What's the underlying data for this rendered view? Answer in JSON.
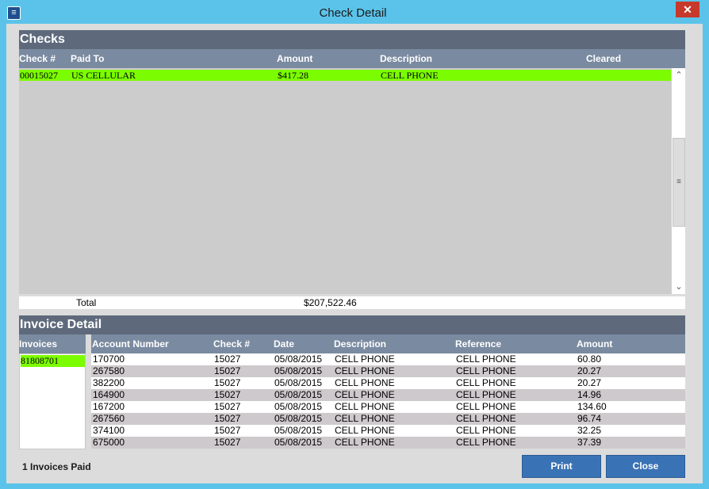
{
  "window": {
    "title": "Check Detail",
    "close_glyph": "✕",
    "icon": "app-icon"
  },
  "checks": {
    "section_title": "Checks",
    "columns": [
      "Check #",
      "Paid To",
      "Amount",
      "Description",
      "Cleared"
    ],
    "rows": [
      {
        "check_no": "00015027",
        "paid_to": "US CELLULAR",
        "amount": "$417.28",
        "description": "CELL PHONE",
        "cleared": ""
      }
    ],
    "total_label": "Total",
    "total_value": "$207,522.46"
  },
  "invoice_detail": {
    "section_title": "Invoice Detail",
    "invoices_header": "Invoices",
    "invoices": [
      "81808701"
    ],
    "columns": [
      "Account Number",
      "Check #",
      "Date",
      "Description",
      "Reference",
      "Amount"
    ],
    "rows": [
      [
        "170700",
        "15027",
        "05/08/2015",
        "CELL PHONE",
        "CELL PHONE",
        "60.80"
      ],
      [
        "267580",
        "15027",
        "05/08/2015",
        "CELL PHONE",
        "CELL PHONE",
        "20.27"
      ],
      [
        "382200",
        "15027",
        "05/08/2015",
        "CELL PHONE",
        "CELL PHONE",
        "20.27"
      ],
      [
        "164900",
        "15027",
        "05/08/2015",
        "CELL PHONE",
        "CELL PHONE",
        "14.96"
      ],
      [
        "167200",
        "15027",
        "05/08/2015",
        "CELL PHONE",
        "CELL PHONE",
        "134.60"
      ],
      [
        "267560",
        "15027",
        "05/08/2015",
        "CELL PHONE",
        "CELL PHONE",
        "96.74"
      ],
      [
        "374100",
        "15027",
        "05/08/2015",
        "CELL PHONE",
        "CELL PHONE",
        "32.25"
      ],
      [
        "675000",
        "15027",
        "05/08/2015",
        "CELL PHONE",
        "CELL PHONE",
        "37.39"
      ]
    ]
  },
  "footer": {
    "invoices_paid": "1 Invoices Paid",
    "print_label": "Print",
    "close_label": "Close"
  },
  "colors": {
    "selected_row": "#7cfc00",
    "section_header": "#5e6a7c",
    "column_header": "#7a8aa0",
    "button": "#3a73b5",
    "window_frame": "#5bc3ea"
  }
}
